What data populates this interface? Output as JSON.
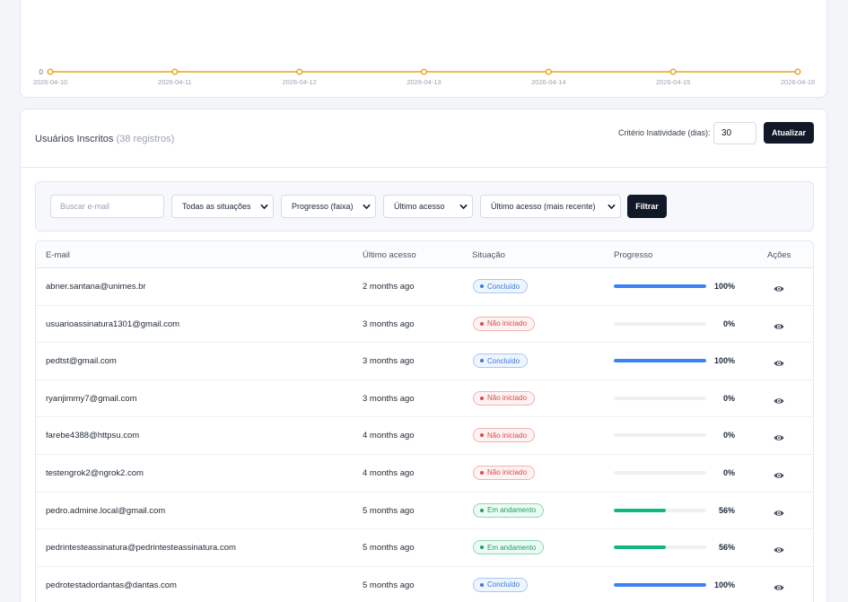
{
  "chart_data": {
    "type": "line",
    "x": [
      "2026-04-10",
      "2026-04-11",
      "2026-04-12",
      "2026-04-13",
      "2026-04-14",
      "2026-04-15",
      "2026-04-16"
    ],
    "y_tick_labels": [
      "0"
    ],
    "series": [
      {
        "values": [
          0,
          0,
          0,
          0,
          0,
          0,
          0
        ],
        "color": "#e8a317"
      }
    ],
    "grid": false
  },
  "users": {
    "title": "Usuários Inscritos",
    "count_label": "(38 registros)",
    "criterion_label": "Critério Inatividade (dias):",
    "criterion_value": "30",
    "update_button": "Atualizar"
  },
  "filters": {
    "search_placeholder": "Buscar e-mail",
    "status_select": "Todas as situações",
    "progress_select": "Progresso (faixa)",
    "last_access_select": "Último acesso",
    "sort_select": "Último acesso (mais recente)",
    "filter_button": "Filtrar"
  },
  "table": {
    "headers": {
      "email": "E-mail",
      "last_access": "Último acesso",
      "status": "Situação",
      "progress": "Progresso",
      "actions": "Ações"
    },
    "rows": [
      {
        "email": "abner.santana@unimes.br",
        "last_access": "2 months ago",
        "status": "Concluído",
        "status_kind": "done",
        "progress": 100,
        "progress_label": "100%"
      },
      {
        "email": "usuarioassinatura1301@gmail.com",
        "last_access": "3 months ago",
        "status": "Não iniciado",
        "status_kind": "not",
        "progress": 0,
        "progress_label": "0%"
      },
      {
        "email": "pedtst@gmail.com",
        "last_access": "3 months ago",
        "status": "Concluído",
        "status_kind": "done",
        "progress": 100,
        "progress_label": "100%"
      },
      {
        "email": "ryanjimmy7@gmail.com",
        "last_access": "3 months ago",
        "status": "Não iniciado",
        "status_kind": "not",
        "progress": 0,
        "progress_label": "0%"
      },
      {
        "email": "farebe4388@httpsu.com",
        "last_access": "4 months ago",
        "status": "Não iniciado",
        "status_kind": "not",
        "progress": 0,
        "progress_label": "0%"
      },
      {
        "email": "testengrok2@ngrok2.com",
        "last_access": "4 months ago",
        "status": "Não iniciado",
        "status_kind": "not",
        "progress": 0,
        "progress_label": "0%"
      },
      {
        "email": "pedro.admine.local@gmail.com",
        "last_access": "5 months ago",
        "status": "Em andamento",
        "status_kind": "prog",
        "progress": 56,
        "progress_label": "56%"
      },
      {
        "email": "pedrintesteassinatura@pedrintesteassinatura.com",
        "last_access": "5 months ago",
        "status": "Em andamento",
        "status_kind": "prog",
        "progress": 56,
        "progress_label": "56%"
      },
      {
        "email": "pedrotestadordantas@dantas.com",
        "last_access": "5 months ago",
        "status": "Concluído",
        "status_kind": "done",
        "progress": 100,
        "progress_label": "100%"
      }
    ]
  },
  "colors": {
    "progress_done": "#3b82f6",
    "progress_partial": "#10b981",
    "line_color": "#e8a317"
  }
}
